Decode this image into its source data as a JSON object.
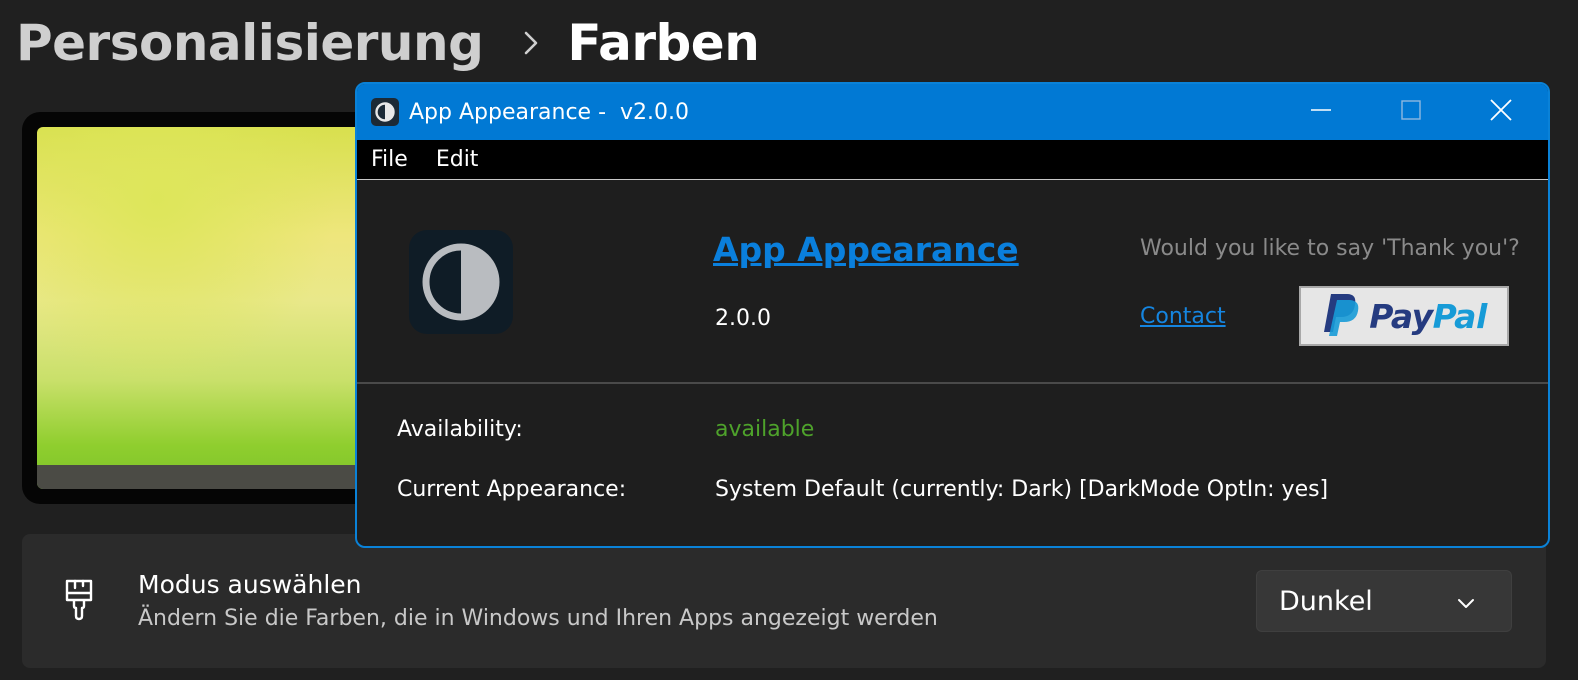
{
  "breadcrumb": {
    "parent": "Personalisierung",
    "current": "Farben"
  },
  "mode_setting": {
    "title": "Modus auswählen",
    "description": "Ändern Sie die Farben, die in Windows und Ihren Apps angezeigt werden",
    "selected": "Dunkel",
    "icon": "paintbrush-icon"
  },
  "dialog": {
    "title": "App Appearance -  v2.0.0",
    "menu": [
      "File",
      "Edit"
    ],
    "app_name": "App Appearance",
    "version": "2.0.0",
    "thank_you": "Would you like to say 'Thank you'?",
    "contact": "Contact",
    "paypal": {
      "part1": "Pay",
      "part2": "Pal"
    },
    "info": {
      "availability_label": "Availability:",
      "availability_value": "available",
      "appearance_label": "Current Appearance:",
      "appearance_value": "System Default (currently: Dark) [DarkMode OptIn: yes]"
    }
  },
  "colors": {
    "accent": "#0179d4",
    "link": "#0a7fdc",
    "available": "#4ea22b",
    "paypal_dark": "#253b80",
    "paypal_light": "#179bd7"
  }
}
